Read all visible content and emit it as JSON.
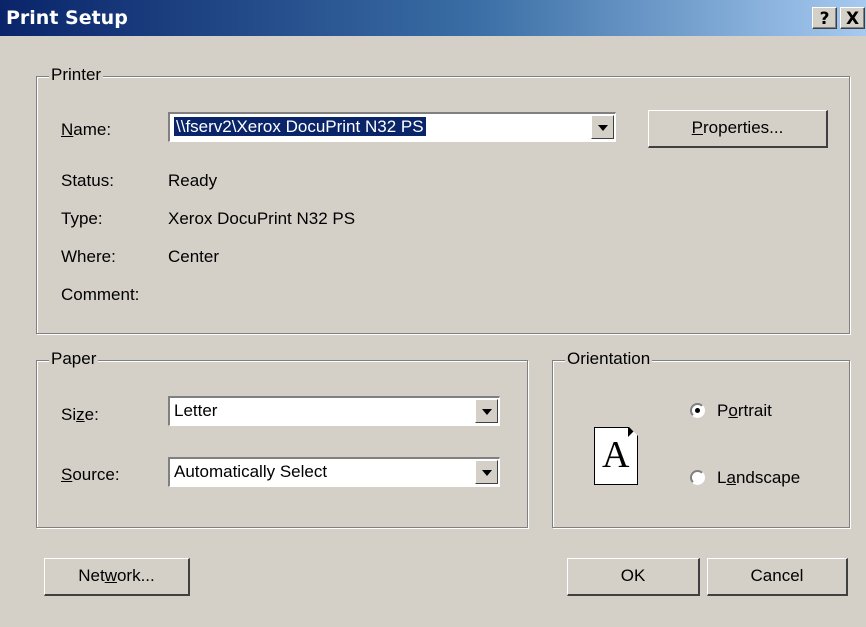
{
  "window": {
    "title": "Print Setup",
    "help_glyph": "?",
    "close_glyph": "X"
  },
  "printer": {
    "legend": "Printer",
    "name_label_u": "N",
    "name_label_rest": "ame:",
    "name_value": "\\\\fserv2\\Xerox DocuPrint N32 PS",
    "properties_u": "P",
    "properties_rest": "roperties...",
    "status_label": "Status:",
    "status_value": "Ready",
    "type_label": "Type:",
    "type_value": "Xerox DocuPrint N32 PS",
    "where_label": "Where:",
    "where_value": "Center",
    "comment_label": "Comment:",
    "comment_value": ""
  },
  "paper": {
    "legend": "Paper",
    "size_label_a": "Si",
    "size_label_u": "z",
    "size_label_b": "e:",
    "size_value": "Letter",
    "source_label_u": "S",
    "source_label_rest": "ource:",
    "source_value": "Automatically Select"
  },
  "orientation": {
    "legend": "Orientation",
    "page_glyph": "A",
    "portrait_a": "P",
    "portrait_u": "o",
    "portrait_b": "rtrait",
    "landscape_a": "L",
    "landscape_u": "a",
    "landscape_b": "ndscape",
    "selected": "portrait"
  },
  "buttons": {
    "network_a": "Net",
    "network_u": "w",
    "network_b": "ork...",
    "ok": "OK",
    "cancel": "Cancel"
  }
}
